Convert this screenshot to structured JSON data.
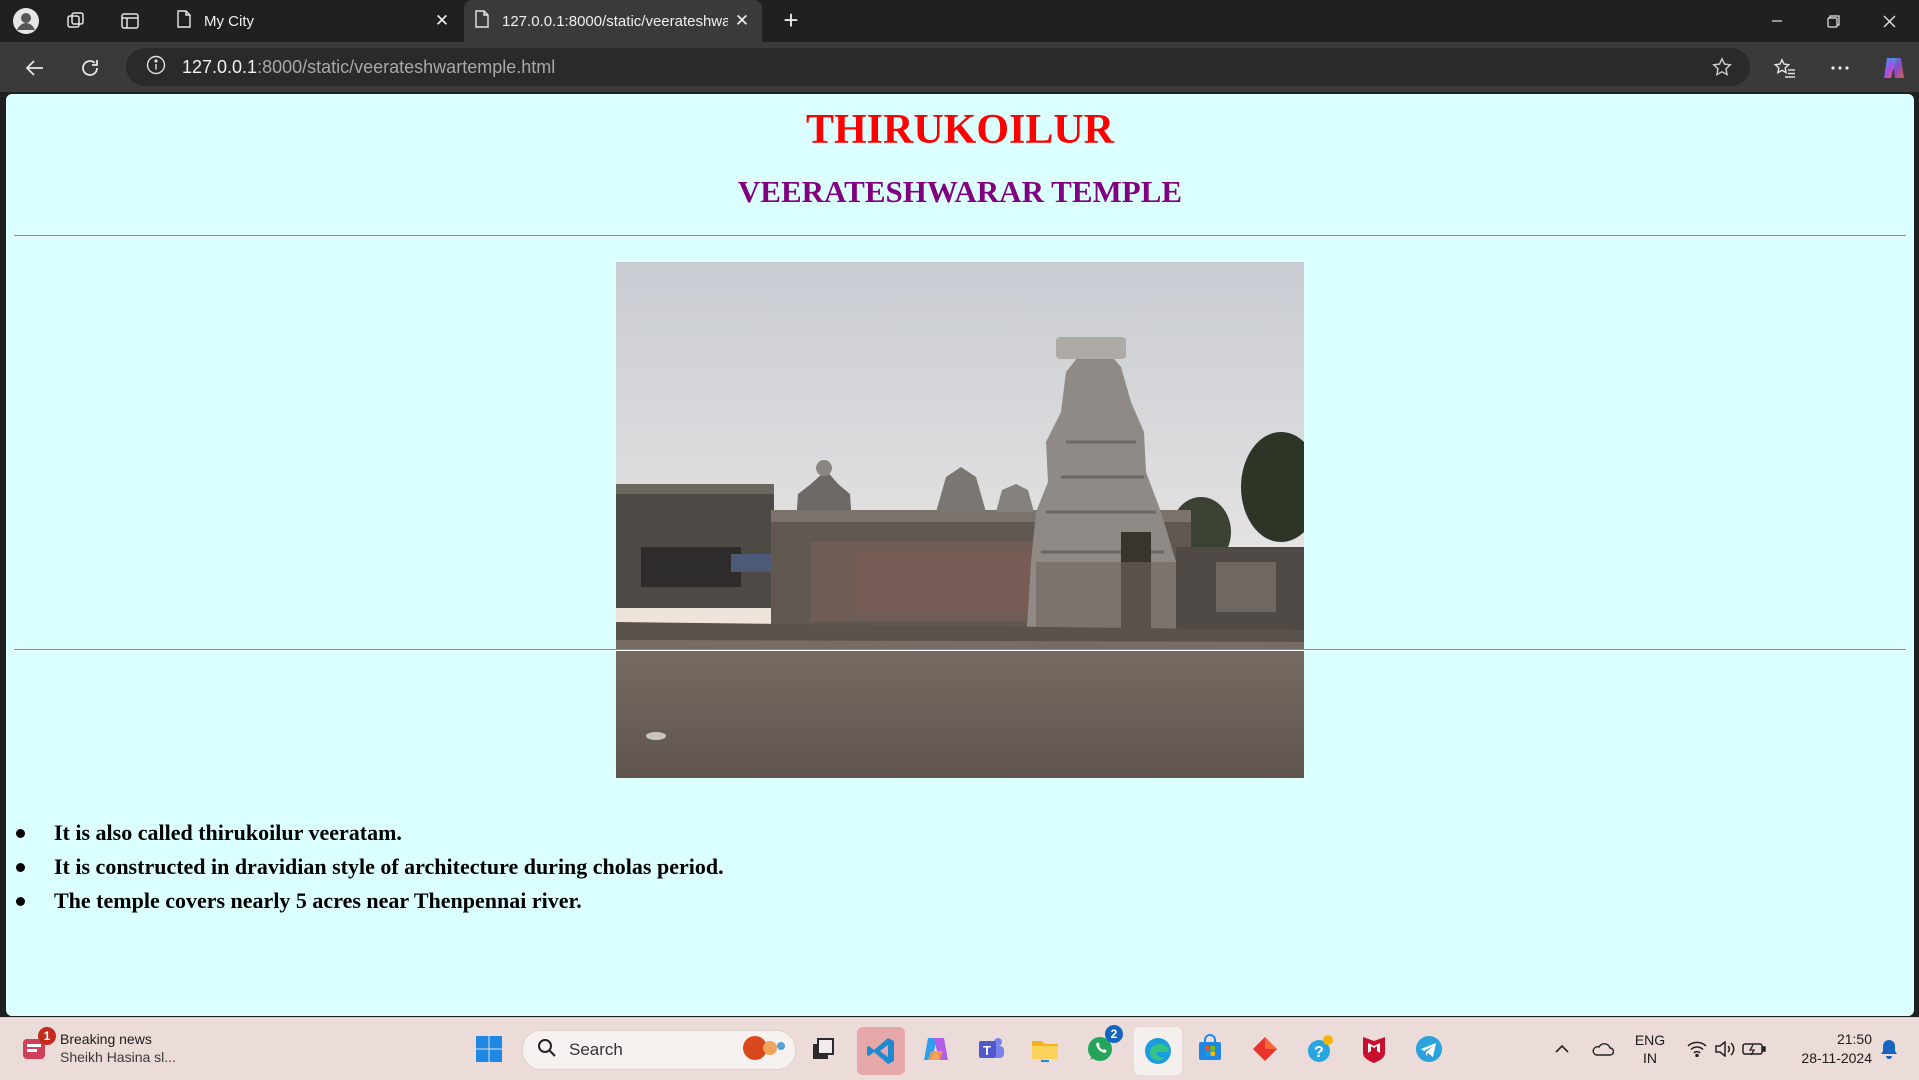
{
  "browser": {
    "tabs": [
      {
        "title": "My City",
        "active": false
      },
      {
        "title": "127.0.0.1:8000/static/veerateshwa",
        "active": true
      }
    ],
    "url_host": "127.0.0.1",
    "url_rest": ":8000/static/veerateshwartemple.html"
  },
  "page": {
    "title": "THIRUKOILUR",
    "subtitle": "VEERATESHWARAR TEMPLE",
    "facts": [
      "It is also called thirukoilur veeratam.",
      "It is constructed in dravidian style of architecture during cholas period.",
      "The temple covers nearly 5 acres near Thenpennai river."
    ]
  },
  "taskbar": {
    "news_title": "Breaking news",
    "news_sub": "Sheikh Hasina sl...",
    "news_badge": "1",
    "search_label": "Search",
    "whatsapp_badge": "2",
    "lang_line1": "ENG",
    "lang_line2": "IN",
    "time": "21:50",
    "date": "28-11-2024"
  },
  "colors": {
    "page_bg": "#dbffff",
    "title": "#ff0000",
    "subtitle": "#800080"
  }
}
